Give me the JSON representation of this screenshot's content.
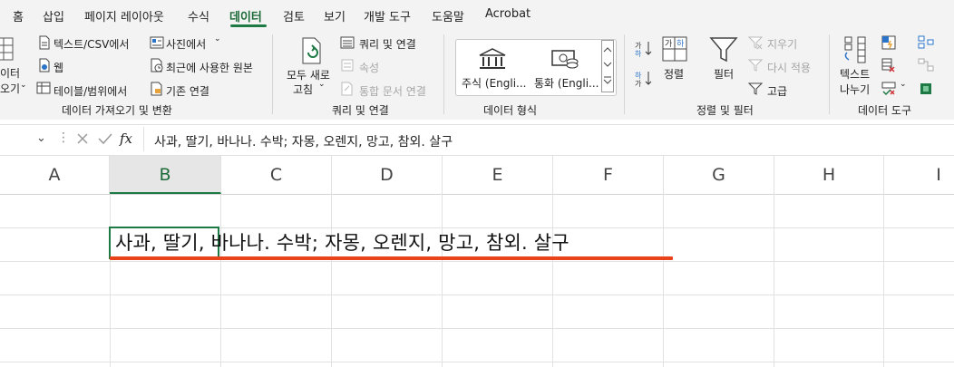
{
  "menu": {
    "tabs": [
      "홈",
      "삽입",
      "페이지 레이아웃",
      "수식",
      "데이터",
      "검토",
      "보기",
      "개발 도구",
      "도움말",
      "Acrobat"
    ],
    "active_tab": "데이터",
    "accent_color": "#1e7a45"
  },
  "ribbon": {
    "get_data": {
      "get_data_label_line1": "이터",
      "get_data_label_line2": "오기",
      "text_csv": "텍스트/CSV에서",
      "web": "웹",
      "table_range": "테이블/범위에서",
      "from_picture": "사진에서",
      "recent_sources": "최근에 사용한 원본",
      "existing_connections": "기존 연결",
      "group_label": "데이터 가져오기 및 변환"
    },
    "queries": {
      "refresh_all_line1": "모두 새로",
      "refresh_all_line2": "고침",
      "queries_connections": "쿼리 및 연결",
      "properties": "속성",
      "edit_links": "통합 문서 연결",
      "group_label": "쿼리 및 연결"
    },
    "data_types": {
      "stocks": "주식 (Engli...",
      "currencies": "통화 (Engli...",
      "group_label": "데이터 형식"
    },
    "sort_filter": {
      "sort": "정렬",
      "filter": "필터",
      "clear": "지우기",
      "reapply": "다시 적용",
      "advanced": "고급",
      "group_label": "정렬 및 필터"
    },
    "data_tools": {
      "text_to_columns_line1": "텍스트",
      "text_to_columns_line2": "나누기",
      "group_label": "데이터 도구"
    }
  },
  "formula_bar": {
    "fx": "fx",
    "content": "사과, 딸기, 바나나. 수박; 자몽, 오렌지, 망고, 참외. 살구"
  },
  "grid": {
    "columns": [
      "A",
      "B",
      "C",
      "D",
      "E",
      "F",
      "G",
      "H",
      "I"
    ],
    "selected_column": "B",
    "cell_text": "사과, 딸기, 바나나. 수박; 자몽, 오렌지, 망고, 참외. 살구"
  }
}
